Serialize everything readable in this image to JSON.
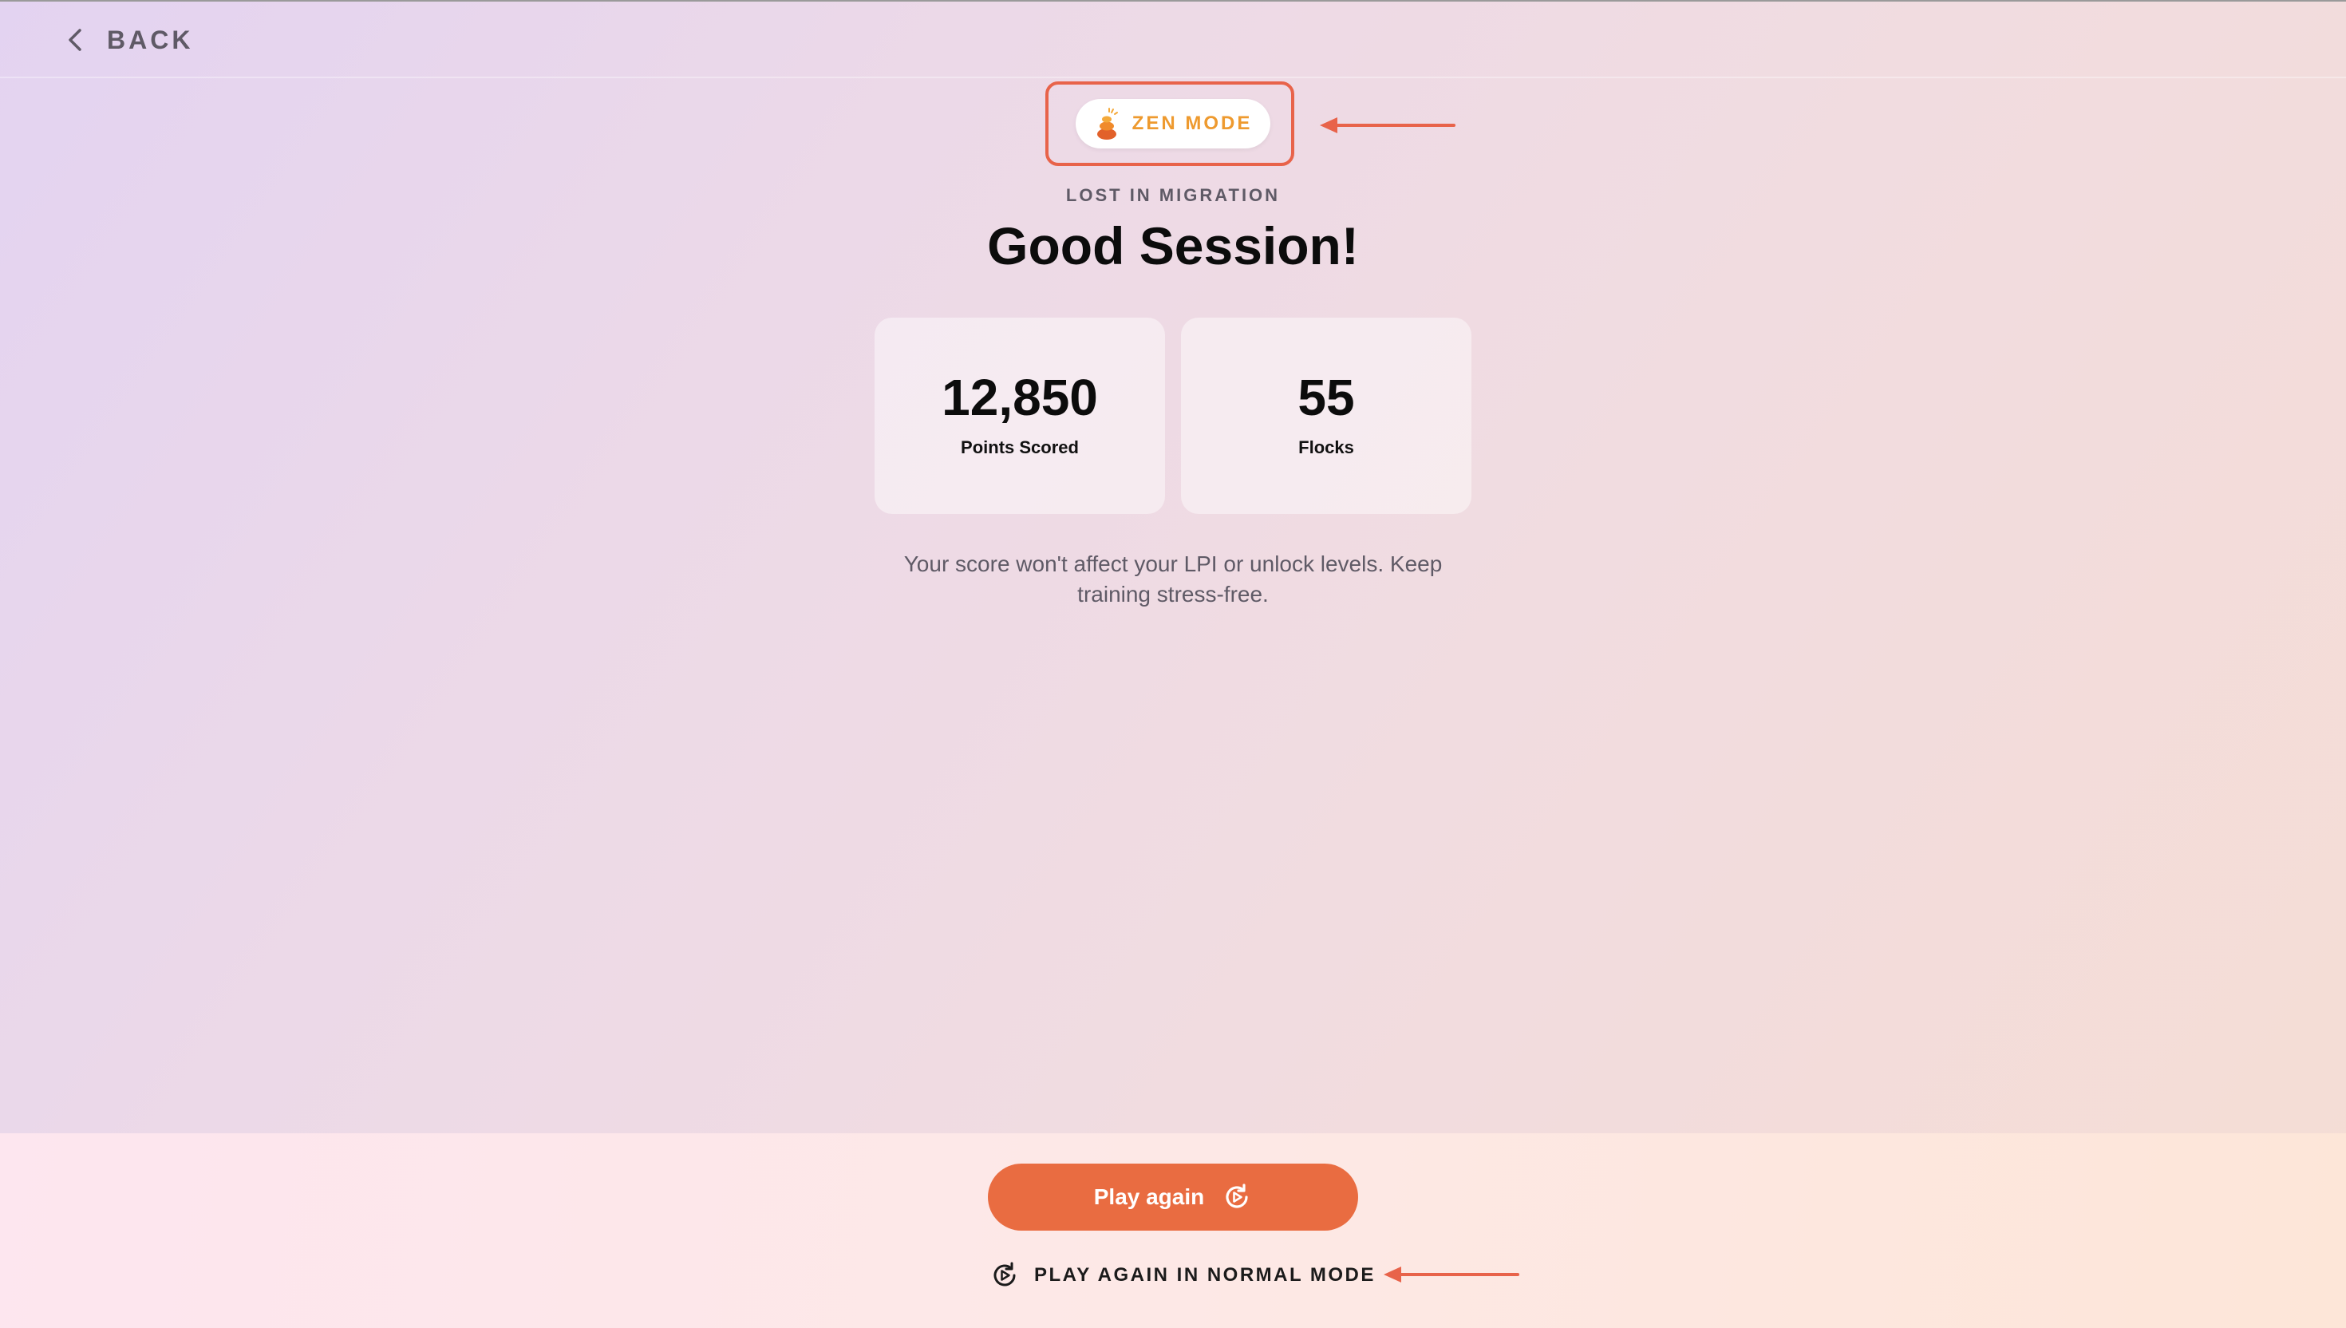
{
  "nav": {
    "back_label": "BACK"
  },
  "badge": {
    "label": "ZEN MODE",
    "icon": "zen-stones-icon"
  },
  "session": {
    "game_name": "LOST IN MIGRATION",
    "title": "Good Session!"
  },
  "stats": [
    {
      "value": "12,850",
      "label": "Points Scored"
    },
    {
      "value": "55",
      "label": "Flocks"
    }
  ],
  "note": "Your score won't affect your LPI or unlock levels. Keep training stress-free.",
  "actions": {
    "play_again_label": "Play again",
    "play_again_icon": "replay-icon",
    "normal_mode_label": "PLAY AGAIN IN NORMAL MODE",
    "normal_mode_icon": "replay-icon"
  },
  "colors": {
    "accent": "#e96c41",
    "annotation": "#e8634a",
    "zen": "#ee9a2f"
  }
}
